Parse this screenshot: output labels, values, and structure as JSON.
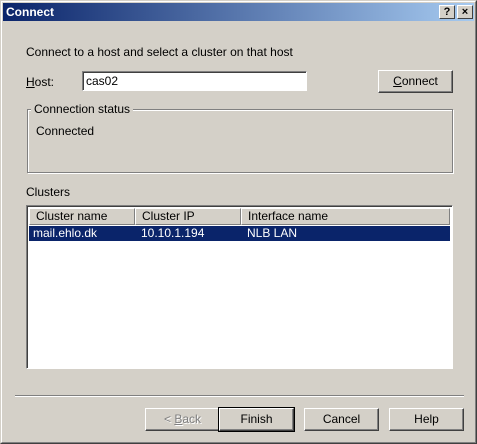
{
  "window": {
    "title": "Connect",
    "help_glyph": "?",
    "close_glyph": "×"
  },
  "intro_text": "Connect to a host and select a cluster on that host",
  "host": {
    "label_mnemonic": "H",
    "label_rest": "ost:",
    "value": "cas02"
  },
  "connect_button": {
    "mnemonic": "C",
    "rest": "onnect"
  },
  "connection_status": {
    "group_label": "Connection status",
    "text": "Connected"
  },
  "clusters": {
    "label": "Clusters",
    "columns": [
      "Cluster name",
      "Cluster IP",
      "Interface name"
    ],
    "rows": [
      {
        "name": "mail.ehlo.dk",
        "ip": "10.10.1.194",
        "interface": "NLB LAN",
        "selected": true
      }
    ]
  },
  "footer": {
    "back_prefix": "< ",
    "back_mnemonic": "B",
    "back_rest": "ack",
    "finish": "Finish",
    "cancel": "Cancel",
    "help": "Help"
  }
}
